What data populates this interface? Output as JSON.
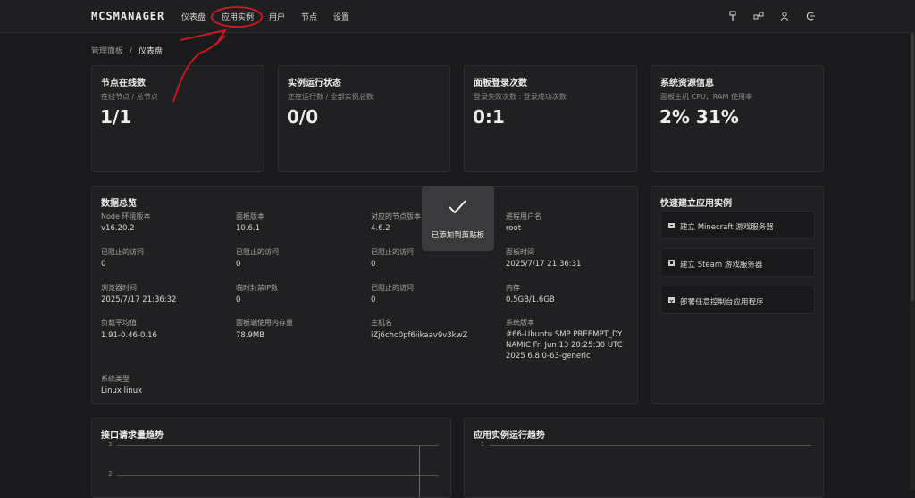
{
  "topbar": {
    "logo": "MCSMANAGER",
    "nav": [
      "仪表盘",
      "应用实例",
      "用户",
      "节点",
      "设置"
    ],
    "icons": [
      "brush-icon",
      "network-icon",
      "user-icon",
      "logout-icon"
    ]
  },
  "breadcrumb": {
    "parent": "管理面板",
    "separator": "/",
    "current": "仪表盘"
  },
  "stats": [
    {
      "title": "节点在线数",
      "subtitle": "在线节点 / 总节点",
      "value": "1/1"
    },
    {
      "title": "实例运行状态",
      "subtitle": "正在运行数 / 全部实例总数",
      "value": "0/0"
    },
    {
      "title": "面板登录次数",
      "subtitle": "登录失败次数 : 登录成功次数",
      "value": "0:1"
    },
    {
      "title": "系统资源信息",
      "subtitle": "面板主机 CPU，RAM 使用率",
      "value": "2% 31%"
    }
  ],
  "overview": {
    "title": "数据总览",
    "items": [
      {
        "label": "Node 环境版本",
        "value": "v16.20.2"
      },
      {
        "label": "面板版本",
        "value": "10.6.1"
      },
      {
        "label": "对应的节点版本",
        "value": "4.6.2"
      },
      {
        "label": "进程用户名",
        "value": "root"
      },
      {
        "label": "已阻止的访问",
        "value": "0"
      },
      {
        "label": "已阻止的访问",
        "value": "0"
      },
      {
        "label": "已阻止的访问",
        "value": "0"
      },
      {
        "label": "面板时间",
        "value": "2025/7/17 21:36:31"
      },
      {
        "label": "浏览器时间",
        "value": "2025/7/17 21:36:32"
      },
      {
        "label": "临时封禁IP数",
        "value": "0"
      },
      {
        "label": "已阻止的访问",
        "value": "0"
      },
      {
        "label": "内存",
        "value": "0.5GB/1.6GB"
      },
      {
        "label": "负载平均值",
        "value": "1.91-0.46-0.16"
      },
      {
        "label": "面板端使用内存量",
        "value": "78.9MB"
      },
      {
        "label": "主机名",
        "value": "iZj6chc0pf6iikaav9v3kwZ"
      },
      {
        "label": "系统版本",
        "value": "#66-Ubuntu SMP PREEMPT_DYNAMIC Fri Jun 13 20:25:30 UTC 2025 6.8.0-63-generic"
      },
      {
        "label": "系统类型",
        "value": "Linux linux"
      }
    ],
    "sysversion_lines": [
      "#66-Ubuntu SMP PREEMPT_DY",
      "NAMIC Fri Jun 13 20:25:30 UTC",
      "2025 6.8.0-63-generic"
    ]
  },
  "quick": {
    "title": "快速建立应用实例",
    "buttons": [
      "建立 Minecraft 游戏服务器",
      "建立 Steam 游戏服务器",
      "部署任意控制台应用程序"
    ]
  },
  "toast": {
    "text": "已添加到剪贴板"
  },
  "charts": {
    "api": {
      "title": "接口请求量趋势",
      "yticks": [
        "3",
        "2"
      ]
    },
    "instance": {
      "title": "应用实例运行趋势",
      "yticks": [
        "1"
      ]
    }
  },
  "colors": {
    "annotation": "#d9181d",
    "spike": "#2f6fd6"
  }
}
